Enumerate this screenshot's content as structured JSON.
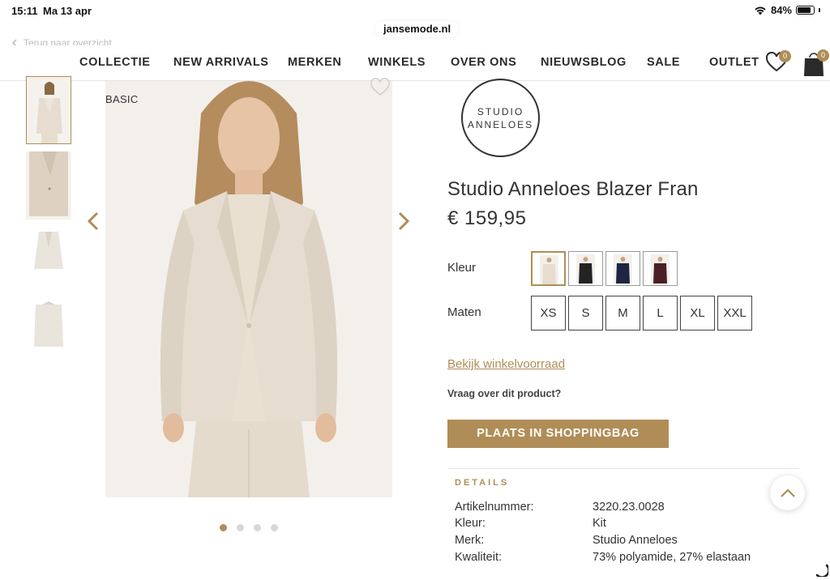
{
  "status_bar": {
    "time": "15:11",
    "date": "Ma 13 apr",
    "battery": "84%",
    "battery_level": 0.84
  },
  "browser": {
    "url": "jansemode.nl"
  },
  "back_link": "Terug naar overzicht",
  "nav": {
    "items": [
      "COLLECTIE",
      "NEW ARRIVALS",
      "MERKEN",
      "WINKELS",
      "OVER ONS",
      "NIEUWSBLOG",
      "SALE",
      "OUTLET"
    ],
    "wishlist_count": "0",
    "bag_count": "0"
  },
  "gallery": {
    "label": "BASIC",
    "thumbnails": 4,
    "active_index": 0
  },
  "product": {
    "brand_logo_lines": [
      "STUDIO",
      "ANNELOES"
    ],
    "title": "Studio Anneloes Blazer Fran",
    "price": "€ 159,95",
    "color_label": "Kleur",
    "color_swatches": [
      {
        "name": "kit",
        "color": "#e6ddd0"
      },
      {
        "name": "black",
        "color": "#232323"
      },
      {
        "name": "navy",
        "color": "#1d2540"
      },
      {
        "name": "burgundy",
        "color": "#4a2026"
      }
    ],
    "size_label": "Maten",
    "sizes": [
      "XS",
      "S",
      "M",
      "L",
      "XL",
      "XXL"
    ],
    "stock_link": "Bekijk winkelvoorraad",
    "ask_link": "Vraag over dit product?",
    "add_to_bag": "PLAATS IN SHOPPINGBAG"
  },
  "details": {
    "heading": "DETAILS",
    "rows": [
      {
        "label": "Artikelnummer:",
        "value": "3220.23.0028"
      },
      {
        "label": "Kleur:",
        "value": "Kit"
      },
      {
        "label": "Merk:",
        "value": "Studio Anneloes"
      },
      {
        "label": "Kwaliteit:",
        "value": "73% polyamide, 27% elastaan"
      }
    ]
  },
  "colors": {
    "accent": "#b08d57",
    "text": "#333333",
    "divider": "#e4e4e4"
  }
}
